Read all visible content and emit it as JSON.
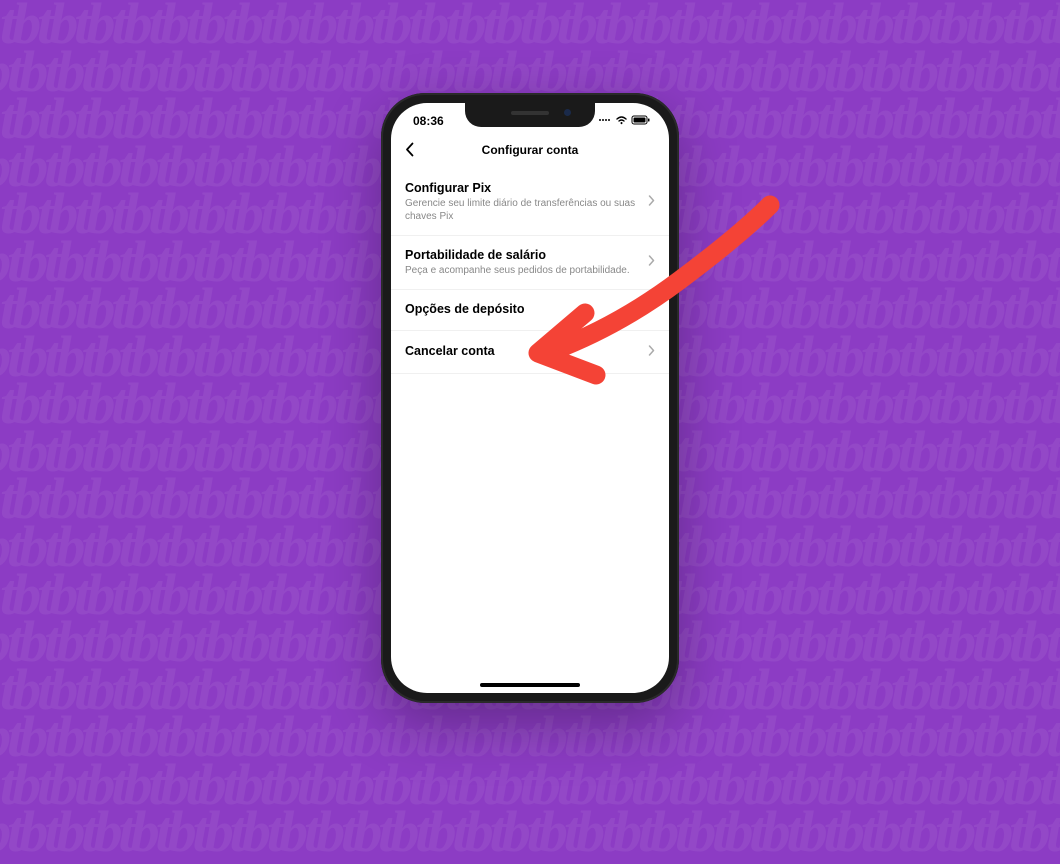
{
  "background": {
    "pattern_text": "tb",
    "color": "#8c3cc4"
  },
  "status_bar": {
    "time": "08:36"
  },
  "header": {
    "title": "Configurar conta"
  },
  "menu": {
    "items": [
      {
        "title": "Configurar Pix",
        "subtitle": "Gerencie seu limite diário de transferências ou suas chaves Pix",
        "has_chevron": true
      },
      {
        "title": "Portabilidade de salário",
        "subtitle": "Peça e acompanhe seus pedidos de portabilidade.",
        "has_chevron": true
      },
      {
        "title": "Opções de depósito",
        "subtitle": "",
        "has_chevron": false
      },
      {
        "title": "Cancelar conta",
        "subtitle": "",
        "has_chevron": true
      }
    ]
  },
  "annotation": {
    "arrow_color": "#f44336",
    "target": "cancelar-conta"
  }
}
